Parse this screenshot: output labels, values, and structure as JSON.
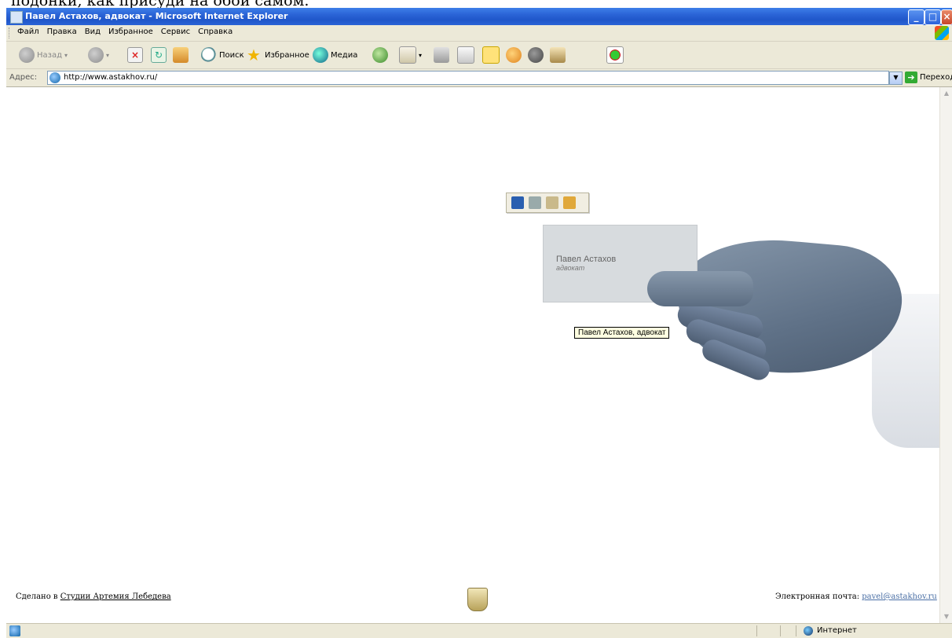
{
  "window": {
    "title": "Павел Астахов, адвокат - Microsoft Internet Explorer",
    "above_text": "подонки, как присуди на обои самом."
  },
  "menu": [
    "Файл",
    "Правка",
    "Вид",
    "Избранное",
    "Сервис",
    "Справка"
  ],
  "toolbar": {
    "back_label": "Назад",
    "search_label": "Поиск",
    "favorites_label": "Избранное",
    "media_label": "Медиа"
  },
  "address": {
    "label": "Адрес:",
    "url": "http://www.astakhov.ru/",
    "go_label": "Переход"
  },
  "card": {
    "name": "Павел Астахов",
    "role": "адвокат",
    "tooltip": "Павел Астахов, адвокат"
  },
  "footer": {
    "made_prefix": "Сделано в ",
    "made_link": "Студии Артемия Лебедева",
    "email_label": "Электронная почта: ",
    "email": "pavel@astakhov.ru"
  },
  "status": {
    "zone": "Интернет"
  }
}
